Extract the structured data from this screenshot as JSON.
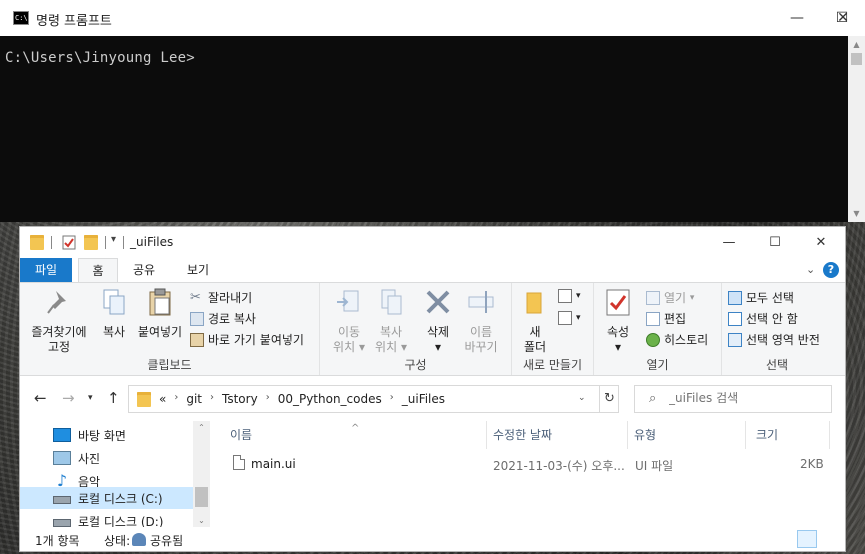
{
  "cmd": {
    "title": "명령 프롬프트",
    "prompt": "C:\\Users\\Jinyoung Lee>",
    "icon": "cmd-icon",
    "icon_text": "C:\\"
  },
  "window_buttons": {
    "minimize": "—",
    "maximize": "☐",
    "close": "✕"
  },
  "explorer": {
    "title": "_uiFiles",
    "tabs": {
      "file": "파일",
      "home": "홈",
      "share": "공유",
      "view": "보기"
    },
    "ribbon": {
      "clipboard": {
        "label": "클립보드",
        "pin": [
          "즐겨찾기에",
          "고정"
        ],
        "copy": "복사",
        "paste": "붙여넣기",
        "cut": "잘라내기",
        "copy_path": "경로 복사",
        "paste_shortcut": "바로 가기 붙여넣기"
      },
      "organize": {
        "label": "구성",
        "move_to": [
          "이동",
          "위치"
        ],
        "copy_to": [
          "복사",
          "위치"
        ],
        "delete": "삭제",
        "rename": [
          "이름",
          "바꾸기"
        ]
      },
      "new": {
        "label": "새로 만들기",
        "new_folder": [
          "새",
          "폴더"
        ]
      },
      "open": {
        "label": "열기",
        "properties": "속성",
        "open": "열기",
        "edit": "편집",
        "history": "히스토리"
      },
      "select": {
        "label": "선택",
        "select_all": "모두 선택",
        "select_none": "선택 안 함",
        "invert": "선택 영역 반전"
      }
    },
    "address": {
      "prefix": "«",
      "crumbs": [
        "git",
        "Tstory",
        "00_Python_codes",
        "_uiFiles"
      ]
    },
    "search": {
      "placeholder": "_uiFiles 검색"
    },
    "nav_pane": [
      {
        "label": "바탕 화면",
        "icon": "desktop-icon"
      },
      {
        "label": "사진",
        "icon": "pictures-icon"
      },
      {
        "label": "음악",
        "icon": "music-icon"
      },
      {
        "label": "로컬 디스크 (C:)",
        "icon": "drive-icon",
        "selected": true
      },
      {
        "label": "로컬 디스크 (D:)",
        "icon": "drive-icon"
      }
    ],
    "columns": {
      "name": "이름",
      "date": "수정한 날짜",
      "type": "유형",
      "size": "크기"
    },
    "files": [
      {
        "name": "main.ui",
        "date": "2021-11-03-(수) 오후...",
        "type": "UI 파일",
        "size": "2KB"
      }
    ],
    "status": {
      "count": "1개 항목",
      "state_label": "상태:",
      "state_value": "공유됨"
    }
  },
  "colors": {
    "accent": "#1979ca",
    "selection": "#cce8ff",
    "folder": "#f3c552"
  }
}
